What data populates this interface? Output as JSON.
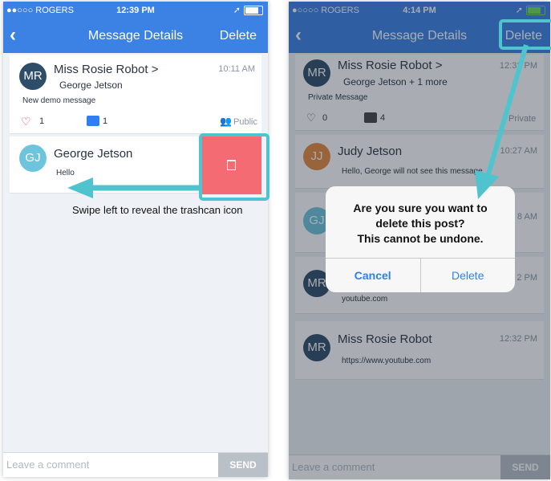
{
  "colors": {
    "header": "#3b82e4",
    "avatar_mr": "#2e4d68",
    "avatar_gj": "#6ec4dc",
    "avatar_jj": "#e58a3c",
    "trash": "#f56b73",
    "highlight": "#4fc4cf"
  },
  "left": {
    "status": {
      "carrier": "●●○○○ ROGERS",
      "time": "12:39 PM"
    },
    "nav": {
      "title": "Message Details",
      "delete": "Delete"
    },
    "post1": {
      "initials": "MR",
      "name": "Miss Rosie Robot >",
      "to": "George Jetson",
      "time": "10:11 AM",
      "message": "New demo message",
      "likes": "1",
      "comments": "1",
      "visibility": "Public"
    },
    "post2": {
      "initials": "GJ",
      "name": "George Jetson",
      "message": "Hello"
    },
    "caption": "Swipe left to reveal the trashcan icon",
    "comment": {
      "placeholder": "Leave a comment",
      "send": "SEND"
    }
  },
  "right": {
    "status": {
      "carrier": "●○○○○ ROGERS",
      "time": "4:14 PM"
    },
    "nav": {
      "title": "Message Details",
      "delete": "Delete"
    },
    "post1": {
      "initials": "MR",
      "name": "Miss Rosie Robot >",
      "to": "George Jetson + 1 more",
      "time": "12:32 PM",
      "message": "Private Message",
      "likes": "0",
      "comments": "4",
      "visibility": "Private"
    },
    "post2": {
      "initials": "JJ",
      "name": "Judy Jetson",
      "time": "10:27 AM",
      "message": "Hello, George will not see this message"
    },
    "post3": {
      "initials": "GJ",
      "time": "8 AM"
    },
    "post4": {
      "initials": "MR",
      "time": "2 PM",
      "message": "youtube.com"
    },
    "post5": {
      "initials": "MR",
      "name": "Miss Rosie Robot",
      "time": "12:32 PM",
      "message": "https://www.youtube.com"
    },
    "dialog": {
      "line1": "Are you sure you want to",
      "line2": "delete this post?",
      "line3": "This cannot be undone.",
      "cancel": "Cancel",
      "delete": "Delete"
    },
    "comment": {
      "placeholder": "Leave a comment",
      "send": "SEND"
    }
  }
}
